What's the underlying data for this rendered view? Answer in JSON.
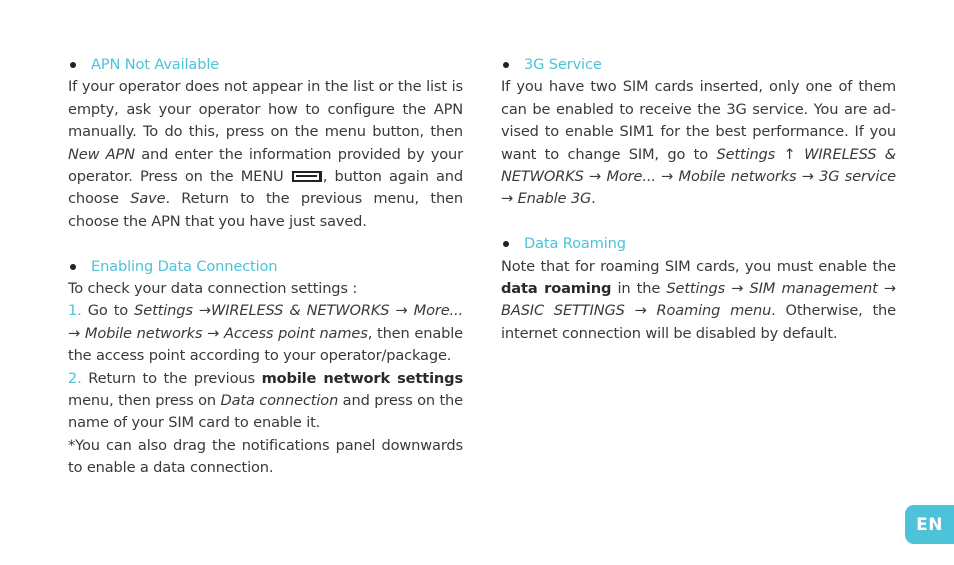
{
  "accent_color": "#4cc3d9",
  "language_tab": {
    "label": "EN"
  },
  "left_column": {
    "apn": {
      "title": "APN Not Available",
      "p1": "If your operator does not appear in the list or the list is empty, ask your operator how to configure the APN manually. To do this, press on the menu button, then ",
      "new_apn": "New APN",
      "p2": " and enter the information provided by your operator. Press on the MENU ",
      "menu_icon": "menu-button-icon",
      "p3": ", button again and choose ",
      "save": "Save",
      "p4": ". Return to the previous menu, then choose the APN that you have just saved."
    },
    "data_connection": {
      "title": "Enabling Data Connection",
      "intro": "To check your data connection settings :",
      "step1_num": "1.",
      "step1_a": " Go to ",
      "step1_path": "Settings →WIRELESS & NETWORKS → More... → Mobile networks → Access point names",
      "step1_b": ", then enable the access point according to your opera­tor/package.",
      "step2_num": "2.",
      "step2_a": " Return to the previous ",
      "step2_bold": "mobile network settings",
      "step2_b": " menu, then press on ",
      "step2_it": "Data connection",
      "step2_c": " and press on the name of your SIM card to enable it.",
      "note": "*You can also drag the notifications panel downwards to enable a data connection."
    }
  },
  "right_column": {
    "service_3g": {
      "title": "3G Service",
      "p1": "If you have two SIM cards inserted, only one of them can be enabled to receive the 3G service. You are ad­vised to enable SIM1 for the best performance. If you want to change SIM, go to ",
      "path": "Settings ↑ WIRELESS & NETWORKS → More... → Mobile networks → 3G ser­vice → Enable 3G",
      "p2": "."
    },
    "data_roaming": {
      "title": "Data Roaming",
      "p1": "Note that for roaming SIM cards, you must enable the ",
      "bold": "data roaming",
      "p2": " in the ",
      "path": "Settings → SIM management → BASIC SETTINGS → Roaming menu",
      "p3": ". Otherwise, the internet connection will be disabled by default."
    }
  }
}
